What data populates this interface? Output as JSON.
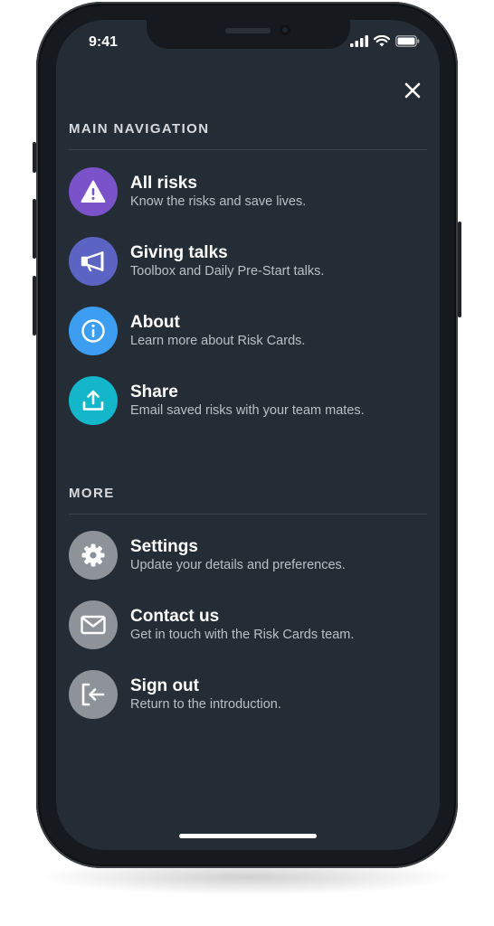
{
  "status_bar": {
    "time": "9:41"
  },
  "sections": {
    "main": {
      "title": "MAIN NAVIGATION",
      "items": [
        {
          "label": "All risks",
          "description": "Know the risks and save lives.",
          "icon": "warning-icon",
          "color": "#7a52c9"
        },
        {
          "label": "Giving talks",
          "description": "Toolbox and Daily Pre-Start talks.",
          "icon": "megaphone-icon",
          "color": "#5b64c2"
        },
        {
          "label": "About",
          "description": "Learn more about Risk Cards.",
          "icon": "info-icon",
          "color": "#3d9df0"
        },
        {
          "label": "Share",
          "description": "Email saved risks with your team mates.",
          "icon": "upload-icon",
          "color": "#14b6cc"
        }
      ]
    },
    "more": {
      "title": "MORE",
      "items": [
        {
          "label": "Settings",
          "description": "Update your details and preferences.",
          "icon": "gear-icon",
          "color": "#8e9399"
        },
        {
          "label": "Contact us",
          "description": "Get in touch with the Risk Cards team.",
          "icon": "mail-icon",
          "color": "#8e9399"
        },
        {
          "label": "Sign out",
          "description": "Return to the introduction.",
          "icon": "sign-out-icon",
          "color": "#8e9399"
        }
      ]
    }
  }
}
